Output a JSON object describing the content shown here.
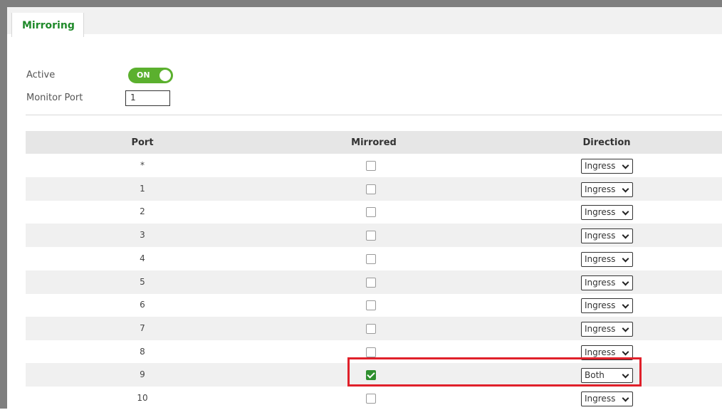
{
  "tab": {
    "label": "Mirroring"
  },
  "settings": {
    "active_label": "Active",
    "active_toggle": "ON",
    "monitor_port_label": "Monitor Port",
    "monitor_port_value": "1"
  },
  "table": {
    "headers": {
      "port": "Port",
      "mirrored": "Mirrored",
      "direction": "Direction"
    },
    "rows": [
      {
        "port": "*",
        "mirrored": false,
        "direction": "Ingress"
      },
      {
        "port": "1",
        "mirrored": false,
        "direction": "Ingress"
      },
      {
        "port": "2",
        "mirrored": false,
        "direction": "Ingress"
      },
      {
        "port": "3",
        "mirrored": false,
        "direction": "Ingress"
      },
      {
        "port": "4",
        "mirrored": false,
        "direction": "Ingress"
      },
      {
        "port": "5",
        "mirrored": false,
        "direction": "Ingress"
      },
      {
        "port": "6",
        "mirrored": false,
        "direction": "Ingress"
      },
      {
        "port": "7",
        "mirrored": false,
        "direction": "Ingress"
      },
      {
        "port": "8",
        "mirrored": false,
        "direction": "Ingress"
      },
      {
        "port": "9",
        "mirrored": true,
        "direction": "Both"
      },
      {
        "port": "10",
        "mirrored": false,
        "direction": "Ingress"
      }
    ]
  },
  "colors": {
    "accent_green": "#1f8a2a",
    "toggle_green": "#5bb02e",
    "highlight_red": "#e0202a"
  }
}
